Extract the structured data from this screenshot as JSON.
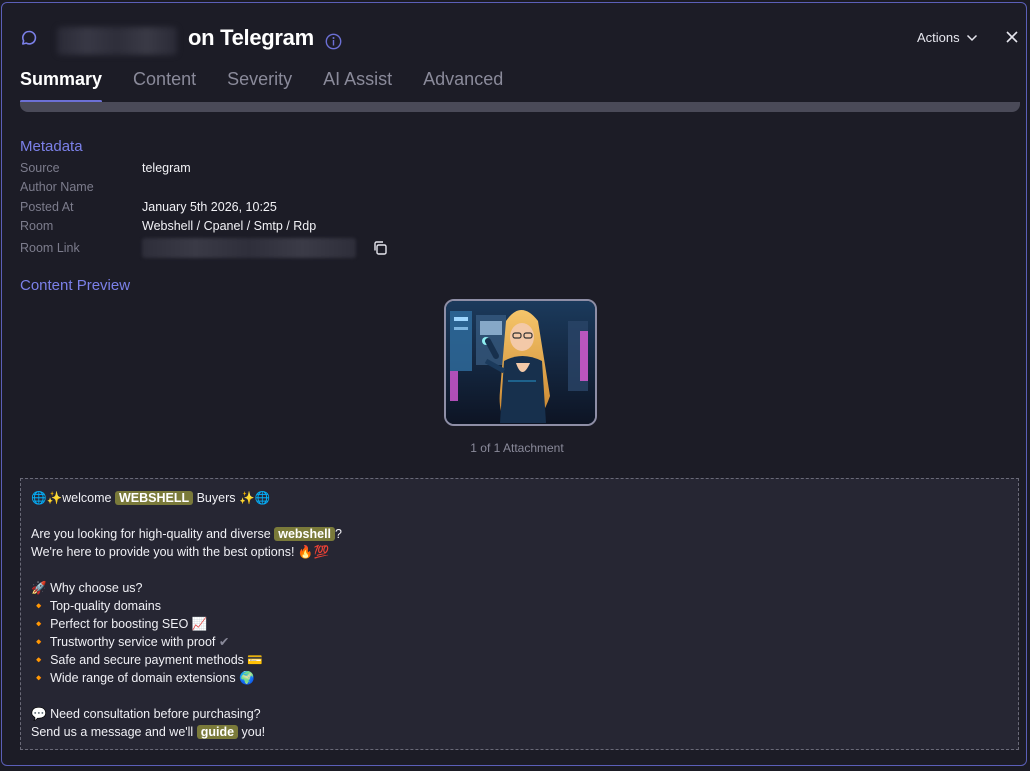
{
  "header": {
    "title": "on Telegram",
    "actions_label": "Actions"
  },
  "tabs": [
    "Summary",
    "Content",
    "Severity",
    "AI Assist",
    "Advanced"
  ],
  "active_tab": "Summary",
  "metadata": {
    "section_title": "Metadata",
    "rows": [
      {
        "label": "Source",
        "value": "telegram"
      },
      {
        "label": "Author Name",
        "value": ""
      },
      {
        "label": "Posted At",
        "value": "January 5th 2026, 10:25"
      },
      {
        "label": "Room",
        "value": "Webshell / Cpanel / Smtp / Rdp"
      },
      {
        "label": "Room Link",
        "value": ""
      }
    ]
  },
  "content_preview": {
    "section_title": "Content Preview",
    "attachment_count": "1 of 1 Attachment"
  },
  "message": {
    "line1_before": "welcome",
    "line1_highlight": "WEBSHELL",
    "line1_after": "Buyers",
    "line2_before": "Are you looking for high-quality and diverse",
    "line2_highlight": "webshell",
    "line2_after": "?",
    "line3": "We're here to provide you with the best options!",
    "line4": "Why choose us?",
    "bullets": [
      "Top-quality domains",
      "Perfect for boosting SEO",
      "Trustworthy service with proof",
      "Safe and secure payment methods",
      "Wide range of domain extensions"
    ],
    "line5": "Need consultation before purchasing?",
    "line6_before": "Send us a message and we'll",
    "line6_highlight": "guide",
    "line6_after": "you!"
  },
  "colors": {
    "accent": "#7b80e8",
    "highlight": "#7a7a3a",
    "background": "#1c1c26"
  }
}
